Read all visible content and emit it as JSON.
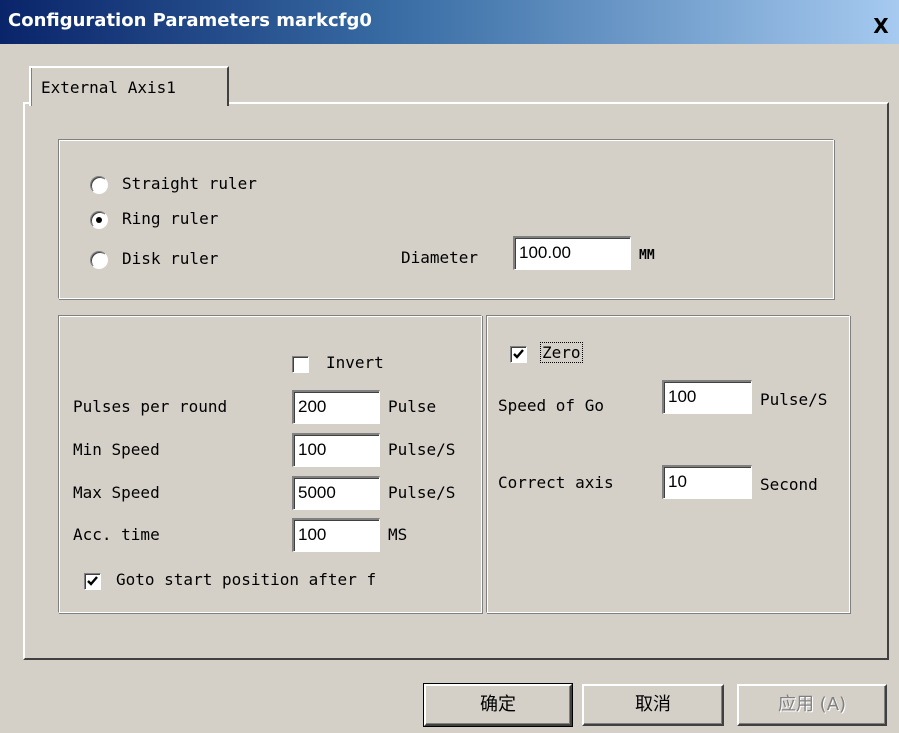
{
  "window": {
    "title": "Configuration Parameters markcfg0",
    "close_label": "X"
  },
  "tabs": [
    {
      "label": "External Axis1",
      "active": true
    }
  ],
  "ruler_group": {
    "options": [
      {
        "label": "Straight ruler",
        "selected": false
      },
      {
        "label": "Ring ruler",
        "selected": true
      },
      {
        "label": "Disk ruler",
        "selected": false
      }
    ],
    "diameter": {
      "label": "Diameter",
      "value": "100.00",
      "unit": "MM"
    }
  },
  "motion_group": {
    "invert": {
      "label": "Invert",
      "checked": false
    },
    "pulses_per_round": {
      "label": "Pulses per round",
      "value": "200",
      "unit": "Pulse"
    },
    "min_speed": {
      "label": "Min Speed",
      "value": "100",
      "unit": "Pulse/S"
    },
    "max_speed": {
      "label": "Max Speed",
      "value": "5000",
      "unit": "Pulse/S"
    },
    "acc_time": {
      "label": "Acc. time",
      "value": "100",
      "unit": "MS"
    },
    "goto_start": {
      "label": "Goto start position after f",
      "checked": true
    }
  },
  "zero_group": {
    "zero": {
      "label": "Zero",
      "checked": true
    },
    "speed_of_go": {
      "label": "Speed of Go",
      "value": "100",
      "unit": "Pulse/S"
    },
    "correct_axis": {
      "label": "Correct axis",
      "value": "10",
      "unit": "Second"
    }
  },
  "buttons": {
    "ok": "确定",
    "cancel": "取消",
    "apply": "应用 (A)"
  }
}
